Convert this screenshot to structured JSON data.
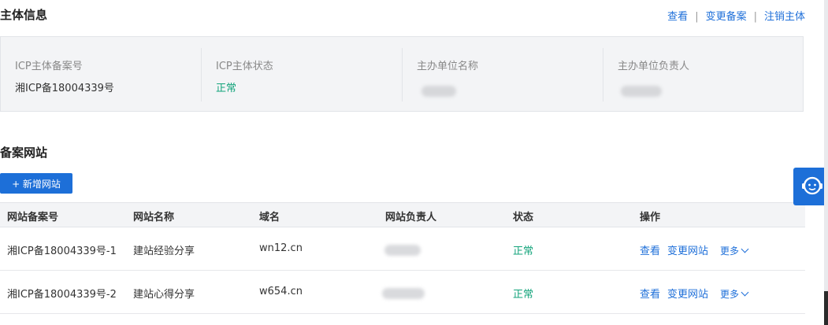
{
  "subject": {
    "title": "主体信息",
    "actions": [
      "查看",
      "变更备案",
      "注销主体"
    ],
    "fields": [
      {
        "label": "ICP主体备案号",
        "value": "湘ICP备18004339号"
      },
      {
        "label": "ICP主体状态",
        "value": "正常"
      },
      {
        "label": "主办单位名称",
        "value": ""
      },
      {
        "label": "主办单位负责人",
        "value": ""
      }
    ]
  },
  "websites": {
    "title": "备案网站",
    "add_button": "+ 新增网站",
    "columns": [
      "网站备案号",
      "网站名称",
      "域名",
      "网站负责人",
      "状态",
      "操作"
    ],
    "rows": [
      {
        "record_no": "湘ICP备18004339号-1",
        "name": "建站经验分享",
        "domain": "wn12.cn",
        "status": "正常",
        "ops": [
          "查看",
          "变更网站"
        ],
        "more": "更多"
      },
      {
        "record_no": "湘ICP备18004339号-2",
        "name": "建站心得分享",
        "domain": "w654.cn",
        "status": "正常",
        "ops": [
          "查看",
          "变更网站"
        ],
        "more": "更多"
      }
    ]
  },
  "icons": {
    "customer_service": "headset-smile-icon",
    "more_chevron": "chevron-down-icon"
  },
  "colors": {
    "accent": "#1d6fd8",
    "status_ok": "#12a37a"
  }
}
